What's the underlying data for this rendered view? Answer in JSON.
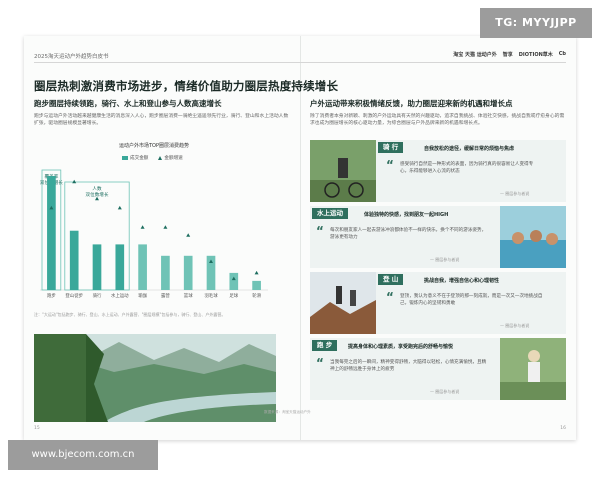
{
  "header": {
    "report_title": "2025淘天运动户外趋势白皮书",
    "logos": [
      "淘宝 天猫 运动户外",
      "智享",
      "DIOTION草木",
      "Cb"
    ]
  },
  "main_title": "圈层热刺激消费市场进步，情绪价值助力圈层热度持续增长",
  "left": {
    "section_title": "跑步圈层持续领跑，骑行、水上和登山参与人数高速增长",
    "section_body": "跑步与运动户外活动越来越健康生活的消息深入人心，跑步圈层消费一骑绝尘遥遥领先行业，骑行、登山和水上活动人数扩张，驱动圈层规模显著增长。",
    "chart_note": "注：\"大运动\"包括跑步、骑行、登山、水上运动、户外露营、\"圈层规模\"包括参与，骑行、登山、户外露营。",
    "footer_note": "数据来源：淘宝天猫运动户外"
  },
  "chart_data": {
    "type": "bar",
    "title": "运动户外市场TOP圈层消费趋势",
    "categories": [
      "跑步",
      "登山徒步",
      "骑行",
      "水上运动",
      "瑜伽",
      "露营",
      "篮球",
      "羽毛球",
      "足球",
      "轮滑"
    ],
    "series": [
      {
        "name": "成交金额",
        "values": [
          100,
          52,
          40,
          40,
          40,
          30,
          30,
          30,
          15,
          8
        ]
      },
      {
        "name": "金额增速",
        "values": [
          72,
          95,
          80,
          72,
          55,
          55,
          48,
          25,
          10,
          15
        ]
      }
    ],
    "annotations": [
      {
        "text": "覆盖率\n双位数增长"
      },
      {
        "text": "人数\n双位数增长"
      }
    ],
    "legend_position": "top",
    "grid": false,
    "colors": {
      "bar": "#3aa89a",
      "highlight": "#6fc3b6",
      "marker": "#1d6e60"
    }
  },
  "right": {
    "section_title": "户外运动带来积极情绪反馈，助力圈层迎来新的机遇和增长点",
    "section_body": "除了消费者本身对新颖、刺激的户外运动具有天然的兴趣驱动，追求自我挑战、体验社交快感，挑战自我或疗愈身心的需求也成为圈层增长的核心驱动力量，为综合圈层与户外品牌来新的机遇和增长点。",
    "cards": [
      {
        "label": "骑 行",
        "subtitle": "自我放松的途径，缓解日常的烦恼与焦虑",
        "quote": "感受骑行自然是一种形式的表面，因为骑行真的很容易让人变得专心，乐得能够进入心流的状态",
        "source": "— 圈层参与者说"
      },
      {
        "label": "水上运动",
        "subtitle": "体验独特的快感，找到朋友一起HIGH",
        "quote": "每次和朋友家人一起去游泳冲浪都体验不一样的快乐，换个不同的游泳姿势，游泳更有动力",
        "source": "— 圈层参与者说"
      },
      {
        "label": "登 山",
        "subtitle": "挑战自我，增强自信心和心理韧性",
        "quote": "登顶，我认为意义不在于登顶的那一刻成就，而是一次又一次地挑战自己，锻炼内心的坚韧和勇敢",
        "source": "— 圈层参与者说"
      },
      {
        "label": "跑 步",
        "subtitle": "提高身体和心理素质，享受跑完后的舒畅与愉悦",
        "quote": "当我每完之后的一瞬间，精神变得舒畅，大脑得以轻松，心情充满愉悦，且精神上的舒畅远胜于身体上的疲劳",
        "source": "— 圈层参与者说"
      }
    ]
  },
  "page_numbers": [
    "15",
    "16"
  ],
  "watermarks": {
    "top": "TG: MYYJJPP",
    "bottom": "www.bjecom.com.cn"
  }
}
